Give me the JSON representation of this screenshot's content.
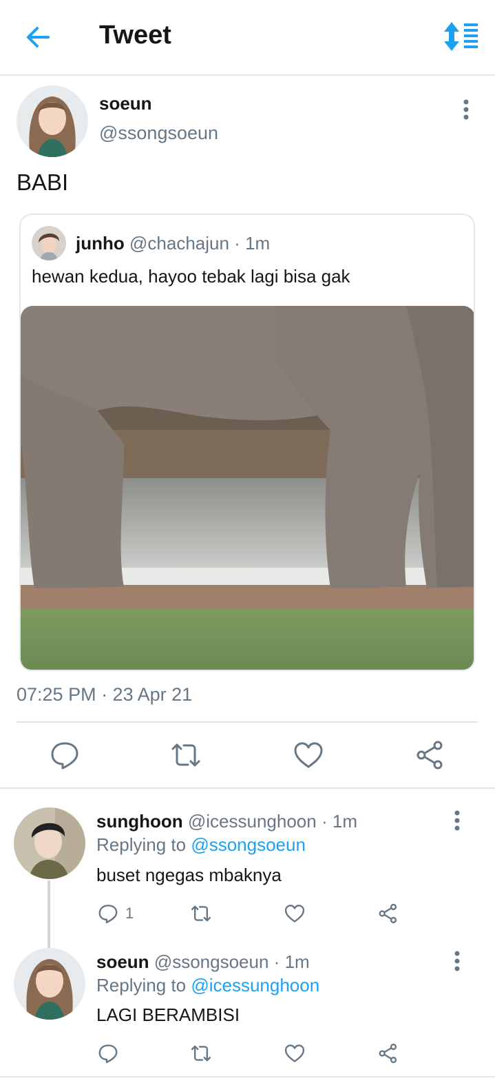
{
  "header": {
    "title": "Tweet"
  },
  "main_tweet": {
    "name": "soeun",
    "handle": "@ssongsoeun",
    "text": "BABI",
    "timestamp": "07:25 PM · 23 Apr 21"
  },
  "quoted_tweet": {
    "name": "junho",
    "handle": "@chachajun",
    "dot": "·",
    "time": "1m",
    "text": "hewan kedua, hayoo tebak lagi bisa gak"
  },
  "replies": [
    {
      "name": "sunghoon",
      "handle": "@icessunghoon",
      "dot": "·",
      "time": "1m",
      "replying_prefix": "Replying to",
      "replying_to": "@ssongsoeun",
      "text": "buset ngegas mbaknya",
      "reply_count": "1"
    },
    {
      "name": "soeun",
      "handle": "@ssongsoeun",
      "dot": "·",
      "time": "1m",
      "replying_prefix": "Replying to",
      "replying_to": "@icessunghoon",
      "text": "LAGI BERAMBISI"
    }
  ],
  "icons": [
    "back-arrow-icon",
    "sort-icon",
    "more-icon",
    "reply-icon",
    "retweet-icon",
    "like-icon",
    "share-icon"
  ],
  "colors": {
    "accent": "#1da1f2",
    "secondary_text": "#657786",
    "primary_text": "#14171a",
    "divider": "#e3e6e8"
  }
}
